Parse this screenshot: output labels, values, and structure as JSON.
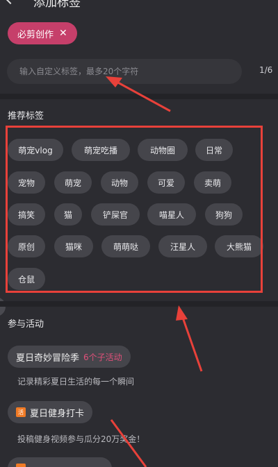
{
  "header": {
    "title": "添加标签"
  },
  "selected_tags": [
    {
      "label": "必剪创作"
    }
  ],
  "custom_input": {
    "placeholder": "输入自定义标签，最多20个字符",
    "counter": "1/6"
  },
  "recommended": {
    "title": "推荐标签",
    "tags": [
      "萌宠vlog",
      "萌宠吃播",
      "动物圈",
      "日常",
      "宠物",
      "萌宠",
      "动物",
      "可爱",
      "卖萌",
      "搞笑",
      "猫",
      "铲屎官",
      "喵星人",
      "狗狗",
      "原创",
      "猫咪",
      "萌萌哒",
      "汪星人",
      "大熊猫",
      "仓鼠"
    ]
  },
  "activities": {
    "title": "参与活动",
    "items": [
      {
        "label": "夏日奇妙冒险季",
        "highlight": "6个子活动",
        "desc": "记录精彩夏日生活的每一个瞬间",
        "icon": ""
      },
      {
        "label": "夏日健身打卡",
        "highlight": "",
        "desc": "投稿健身视频参与瓜分20万奖金！",
        "icon": "活"
      }
    ]
  },
  "colors": {
    "accent": "#c63f6a",
    "annotation": "#e8413a",
    "background": "#2c2c31",
    "tag_bg": "#45454b"
  }
}
